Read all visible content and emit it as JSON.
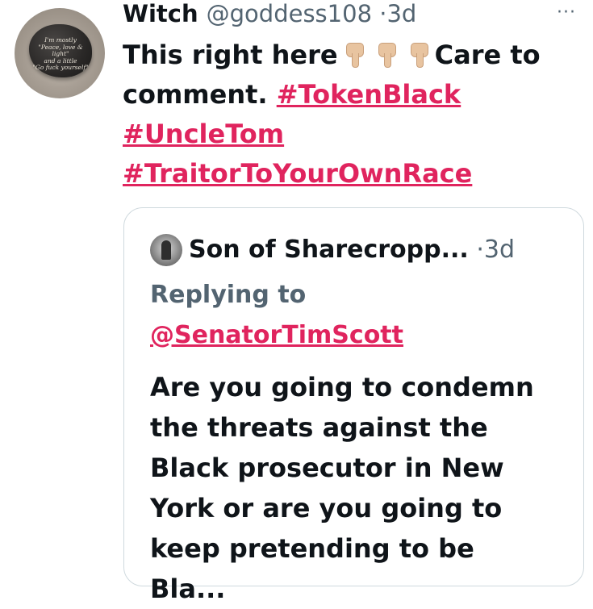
{
  "tweet": {
    "display_name": "Witch",
    "handle": "@goddess108",
    "separator": "·",
    "time": "3d",
    "more_label": "···",
    "avatar": {
      "stone_lines": [
        "I'm mostly",
        "\"Peace, love & light\"",
        "and a little",
        "\"Go fuck yourself\""
      ]
    },
    "text_part1": "This right here",
    "hand_emoji": "point-down-icon",
    "text_part2": "Care to comment.",
    "hashtags": [
      "#TokenBlack",
      "#UncleTom",
      "#TraitorToYourOwnRace"
    ]
  },
  "quoted_tweet": {
    "display_name": "Son of Sharecropp...",
    "separator": "·",
    "time": "3d",
    "replying_label": "Replying to",
    "mention": "@SenatorTimScott",
    "text": "Are you going to condemn the threats against the Black prosecutor in New York or are you going to keep pretending to be Bla..."
  },
  "colors": {
    "hashtag": "#e0245e",
    "secondary_text": "#536471",
    "border": "#cfd9de"
  }
}
